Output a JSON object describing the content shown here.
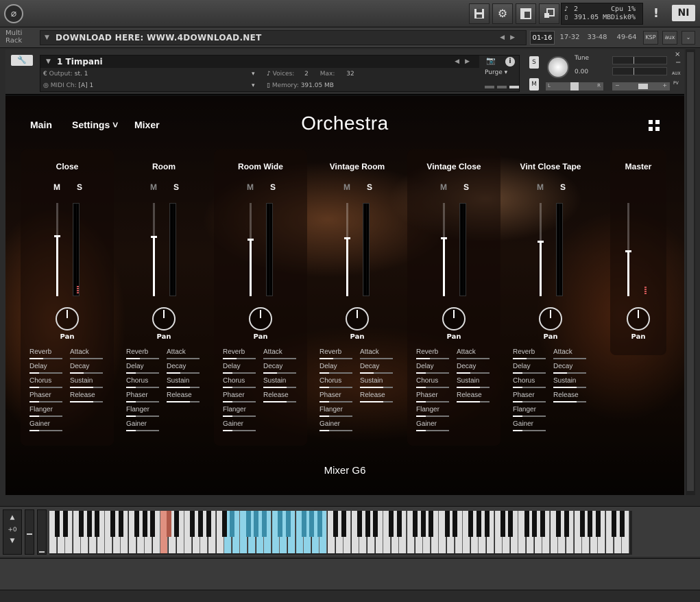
{
  "toolbar": {
    "logo_glyph": "⌀",
    "save_icon": "save-icon",
    "settings_icon": "gear-icon",
    "view_icon": "layout-icon",
    "resize_icon": "resize-icon",
    "voices": "2",
    "memory": "391.05 MB",
    "cpu_label": "Cpu",
    "cpu_value": "1%",
    "disk_label": "Disk",
    "disk_value": "0%",
    "warning": "!",
    "ni_logo": "NI"
  },
  "rack": {
    "label_line1": "Multi",
    "label_line2": "Rack",
    "name": "DOWNLOAD HERE: WWW.4DOWNLOAD.NET",
    "pages": [
      "01-16",
      "17-32",
      "33-48",
      "49-64"
    ],
    "ksp": "KSP",
    "aux": "aux"
  },
  "instrument": {
    "name": "1 Timpani",
    "output_label": "Output:",
    "output_value": "st. 1",
    "midi_label": "MIDI Ch:",
    "midi_value": "[A]  1",
    "voices_label": "Voices:",
    "voices_value": "2",
    "max_label": "Max:",
    "max_value": "32",
    "memory_label": "Memory:",
    "memory_value": "391.05 MB",
    "purge": "Purge",
    "solo": "S",
    "mute": "M",
    "tune_label": "Tune",
    "tune_value": "0.00",
    "pan_left": "L",
    "pan_right": "R",
    "vol_minus": "−",
    "vol_plus": "+",
    "close": "×",
    "minimize": "−",
    "aux": "AUX",
    "pv": "PV"
  },
  "gui": {
    "nav_main": "Main",
    "nav_settings": "Settings ˅",
    "nav_mixer": "Mixer",
    "title": "Orchestra",
    "footer": "Mixer G6",
    "mute_label": "M",
    "solo_label": "S",
    "pan_label": "Pan",
    "fx_left": [
      "Reverb",
      "Delay",
      "Chorus",
      "Phaser",
      "Flanger",
      "Gainer"
    ],
    "fx_right": [
      "Attack",
      "Decay",
      "Sustain",
      "Release"
    ],
    "channels": [
      {
        "name": "Close",
        "fader": 0.64,
        "mute_active": true
      },
      {
        "name": "Room",
        "fader": 0.63,
        "mute_active": false
      },
      {
        "name": "Room Wide",
        "fader": 0.6,
        "mute_active": false
      },
      {
        "name": "Vintage Room",
        "fader": 0.62,
        "mute_active": false
      },
      {
        "name": "Vintage Close",
        "fader": 0.62,
        "mute_active": false
      },
      {
        "name": "Vint Close Tape",
        "fader": 0.58,
        "mute_active": false
      }
    ],
    "master": {
      "name": "Master",
      "fader": 0.48
    }
  },
  "keyboard": {
    "octave": "+0"
  }
}
